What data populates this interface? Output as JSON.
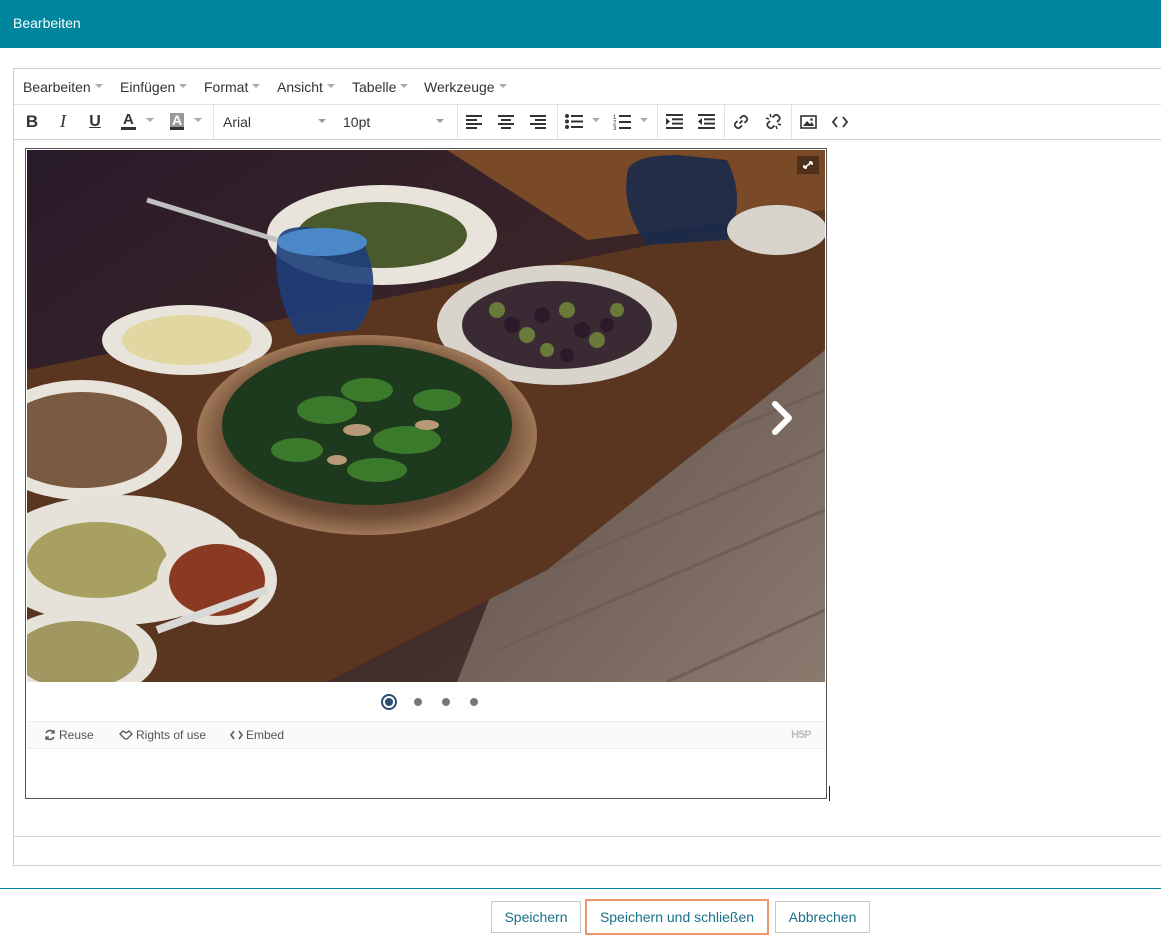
{
  "header": {
    "title": "Bearbeiten"
  },
  "menubar": {
    "items": [
      {
        "label": "Bearbeiten"
      },
      {
        "label": "Einfügen"
      },
      {
        "label": "Format"
      },
      {
        "label": "Ansicht"
      },
      {
        "label": "Tabelle"
      },
      {
        "label": "Werkzeuge"
      }
    ]
  },
  "toolbar": {
    "bold": "B",
    "italic": "I",
    "underline": "U",
    "text_color": "A",
    "bg_color": "A",
    "font_family": "Arial",
    "font_size": "10pt",
    "icons": [
      "bold-icon",
      "italic-icon",
      "underline-icon",
      "text-color-icon",
      "background-color-icon",
      "align-left-icon",
      "align-center-icon",
      "align-right-icon",
      "bullet-list-icon",
      "numbered-list-icon",
      "indent-icon",
      "outdent-icon",
      "link-icon",
      "unlink-icon",
      "image-icon",
      "code-icon"
    ]
  },
  "h5p": {
    "slides_count": 4,
    "active_slide": 1,
    "actions": {
      "reuse": "Reuse",
      "rights": "Rights of use",
      "embed": "Embed"
    },
    "logo": "H5P"
  },
  "buttons": {
    "save": "Speichern",
    "save_close": "Speichern und schließen",
    "cancel": "Abbrechen"
  },
  "colors": {
    "header": "#00859f",
    "accent_outline": "#f0956c",
    "link_text": "#1a6f8a"
  }
}
